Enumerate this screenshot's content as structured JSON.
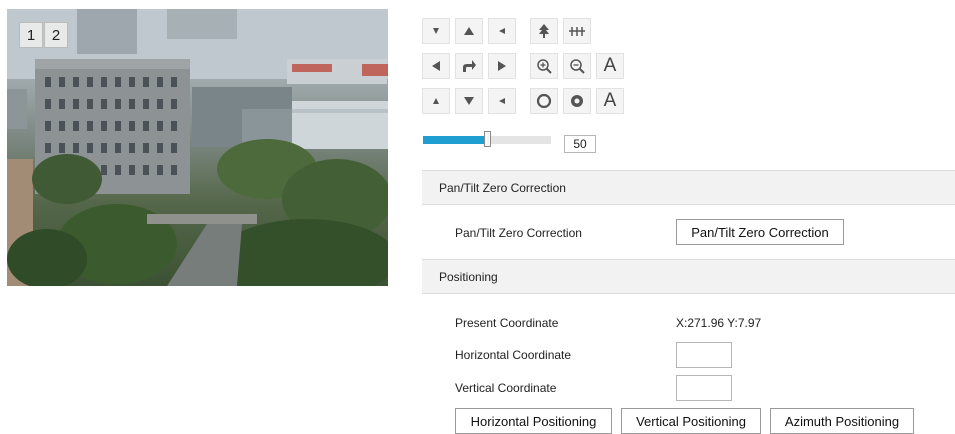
{
  "video": {
    "window_tabs": [
      "1",
      "2"
    ]
  },
  "ptz": {
    "speed_value": "50",
    "speed_fraction": 0.5,
    "controls": [
      "up-left-icon",
      "up-icon",
      "up-right-icon",
      "wiper-icon",
      "light-icon",
      "left-icon",
      "auto-scan-icon",
      "right-icon",
      "zoom-in-icon",
      "zoom-out-icon",
      "focus-near-icon",
      "down-left-icon",
      "down-icon",
      "down-right-icon",
      "iris-open-icon",
      "iris-close-icon",
      "focus-far-icon"
    ],
    "focus_glyph": "A"
  },
  "zero_correction": {
    "header": "Pan/Tilt Zero Correction",
    "row_label": "Pan/Tilt Zero Correction",
    "button_label": "Pan/Tilt Zero Correction"
  },
  "positioning": {
    "header": "Positioning",
    "present_label": "Present Coordinate",
    "present_value": "X:271.96 Y:7.97",
    "horizontal_label": "Horizontal Coordinate",
    "horizontal_value": "",
    "vertical_label": "Vertical Coordinate",
    "vertical_value": "",
    "buttons": {
      "horizontal": "Horizontal Positioning",
      "vertical": "Vertical Positioning",
      "azimuth": "Azimuth Positioning"
    }
  },
  "colors": {
    "accent": "#1f9ed1",
    "section_bg": "#f2f2f2"
  }
}
